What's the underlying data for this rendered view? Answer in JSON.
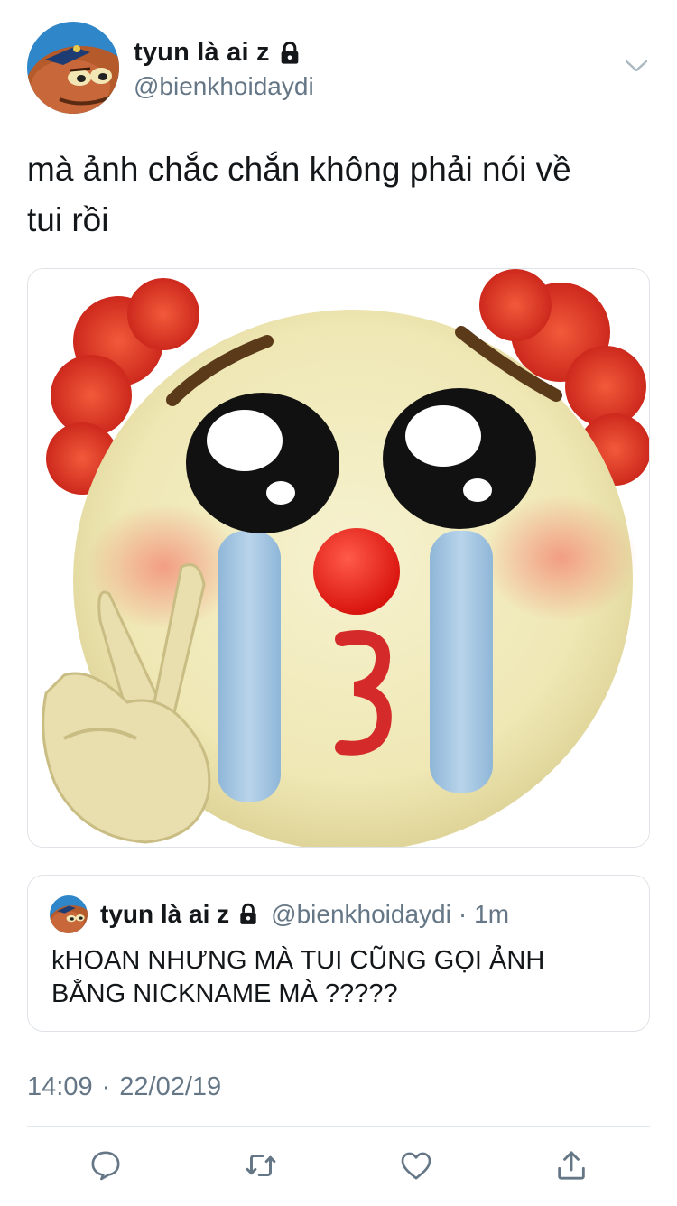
{
  "user": {
    "display_name": "tyun là ai z",
    "handle": "@bienkhoidaydi",
    "avatar_icon": "cartoon-fish-avatar"
  },
  "tweet": {
    "text_line1": "mà ảnh chắc chắn không phải nói về",
    "text_line2": "tui rồi"
  },
  "media": {
    "image_description_icon": "crying-clown-emoji"
  },
  "quoted": {
    "display_name": "tyun là ai z",
    "handle": "@bienkhoidaydi",
    "separator": "·",
    "time": "1m",
    "text_line1": "kHOAN NHƯNG MÀ TUI CŨNG GỌI ẢNH",
    "text_line2": "BẰNG NICKNAME MÀ ?????"
  },
  "meta": {
    "time": "14:09",
    "separator": "·",
    "date": "22/02/19"
  },
  "actions": [
    {
      "name": "reply",
      "icon": "reply-icon"
    },
    {
      "name": "retweet",
      "icon": "retweet-icon"
    },
    {
      "name": "like",
      "icon": "heart-icon"
    },
    {
      "name": "share",
      "icon": "share-icon"
    }
  ],
  "colors": {
    "primary_text": "#14171a",
    "secondary_text": "#657786",
    "border": "#dfe3e7"
  }
}
